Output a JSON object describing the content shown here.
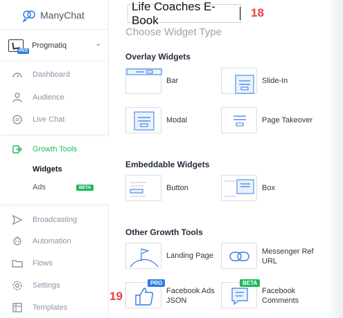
{
  "app": {
    "brand": "ManyChat"
  },
  "account": {
    "name": "Progmatiq",
    "badge": "PRO"
  },
  "sidebar": {
    "items": [
      {
        "label": "Dashboard",
        "icon": "gauge-icon"
      },
      {
        "label": "Audience",
        "icon": "person-icon"
      },
      {
        "label": "Live Chat",
        "icon": "chat-bubble-icon"
      },
      {
        "label": "Growth Tools",
        "icon": "growth-tools-icon"
      },
      {
        "label": "Broadcasting",
        "icon": "paper-plane-icon"
      },
      {
        "label": "Automation",
        "icon": "robot-icon"
      },
      {
        "label": "Flows",
        "icon": "folder-icon"
      },
      {
        "label": "Settings",
        "icon": "gear-icon"
      },
      {
        "label": "Templates",
        "icon": "templates-icon"
      }
    ],
    "growth_sub": [
      {
        "label": "Widgets"
      },
      {
        "label": "Ads",
        "badge": "BETA"
      }
    ]
  },
  "header": {
    "title_value": "Life Coaches E-Book",
    "step_marker_1": "18",
    "step_marker_2": "19"
  },
  "main": {
    "heading": "Choose Widget Type",
    "sections": [
      {
        "title": "Overlay Widgets",
        "widgets": [
          "Bar",
          "Slide-In",
          "Modal",
          "Page Takeover"
        ]
      },
      {
        "title": "Embeddable Widgets",
        "widgets": [
          "Button",
          "Box"
        ]
      },
      {
        "title": "Other Growth Tools",
        "widgets": [
          "Landing Page",
          "Messenger Ref URL",
          "Facebook Ads JSON",
          "Facebook Comments"
        ]
      }
    ],
    "badges": {
      "pro": "PRO",
      "beta": "BETA"
    },
    "multiline": {
      "messenger_ref_1": "Messenger Ref",
      "messenger_ref_2": "URL",
      "fb_ads_1": "Facebook Ads",
      "fb_ads_2": "JSON",
      "fb_comments_1": "Facebook",
      "fb_comments_2": "Comments"
    }
  },
  "colors": {
    "accent_green": "#1fb85c",
    "accent_blue": "#2f7ae5",
    "marker_red": "#e8413c",
    "nav_text": "#8a94a6"
  }
}
